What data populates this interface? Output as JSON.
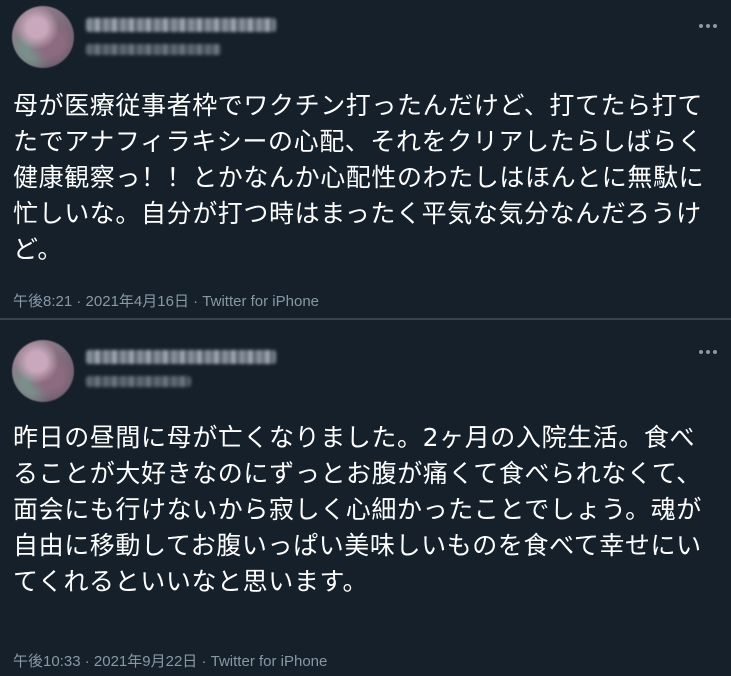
{
  "tweets": [
    {
      "more_icon": "more-horizontal-icon",
      "text": "母が医療従事者枠でワクチン打ったんだけど、打てたら打てたでアナフィラキシーの心配、それをクリアしたらしばらく健康観察っ！！とかなんか心配性のわたしはほんとに無駄に忙しいな。自分が打つ時はまったく平気な気分なんだろうけど。",
      "time": "午後8:21",
      "sep": " · ",
      "date": "2021年4月16日",
      "source": "Twitter for iPhone"
    },
    {
      "more_icon": "more-horizontal-icon",
      "text": "昨日の昼間に母が亡くなりました。2ヶ月の入院生活。食べることが大好きなのにずっとお腹が痛くて食べられなくて、面会にも行けないから寂しく心細かったことでしょう。魂が自由に移動してお腹いっぱい美味しいものを食べて幸せにいてくれるといいなと思います。",
      "time": "午後10:33",
      "sep": " · ",
      "date": "2021年9月22日",
      "source": "Twitter for iPhone"
    }
  ],
  "colors": {
    "background": "#15202b",
    "text": "#ffffff",
    "secondary": "#8899a6",
    "divider": "#38444d"
  }
}
